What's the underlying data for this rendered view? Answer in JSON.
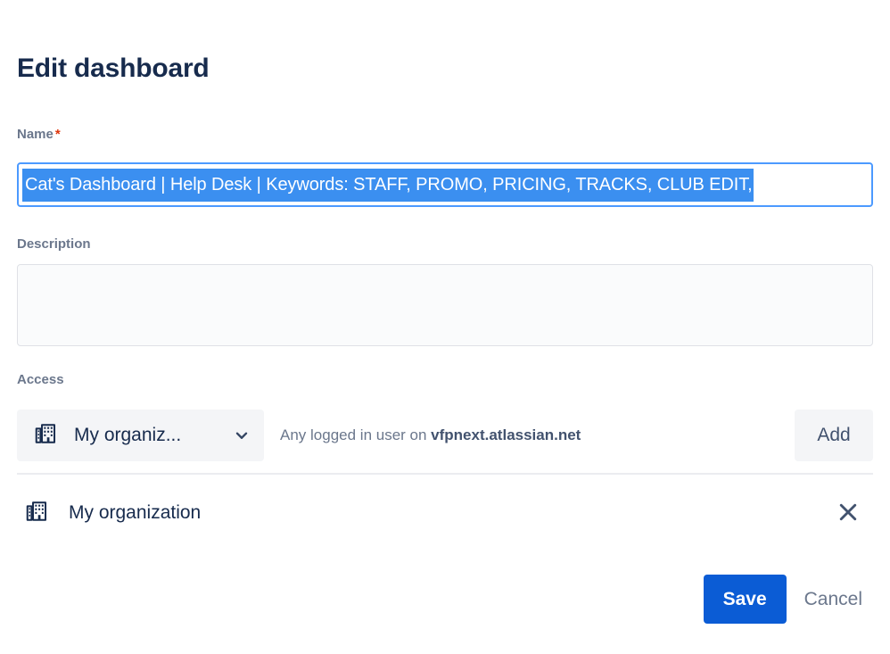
{
  "page": {
    "title": "Edit dashboard"
  },
  "form": {
    "name": {
      "label": "Name",
      "required_marker": "*",
      "value": "Cat's Dashboard | Help Desk | Keywords: STAFF, PROMO, PRICING, TRACKS, CLUB EDIT,",
      "placeholder": "",
      "selected": true
    },
    "description": {
      "label": "Description",
      "value": "",
      "placeholder": ""
    },
    "access": {
      "label": "Access",
      "selector": {
        "icon": "building-icon",
        "value": "My organiz...",
        "chevron_icon": "chevron-down-icon"
      },
      "hint_prefix": "Any logged in user on ",
      "hint_domain": "vfpnext.atlassian.net",
      "add_label": "Add",
      "items": [
        {
          "icon": "building-icon",
          "label": "My organization",
          "remove_icon": "close-icon"
        }
      ]
    }
  },
  "footer": {
    "save_label": "Save",
    "cancel_label": "Cancel"
  },
  "colors": {
    "primary_blue": "#0b5cd5",
    "focus_border": "#4c9aff",
    "selection_blue": "#3b8ff0",
    "text_dark": "#172b4d",
    "text_subtle": "#6b778c",
    "required_red": "#de350b",
    "surface_grey": "#f4f5f7"
  }
}
